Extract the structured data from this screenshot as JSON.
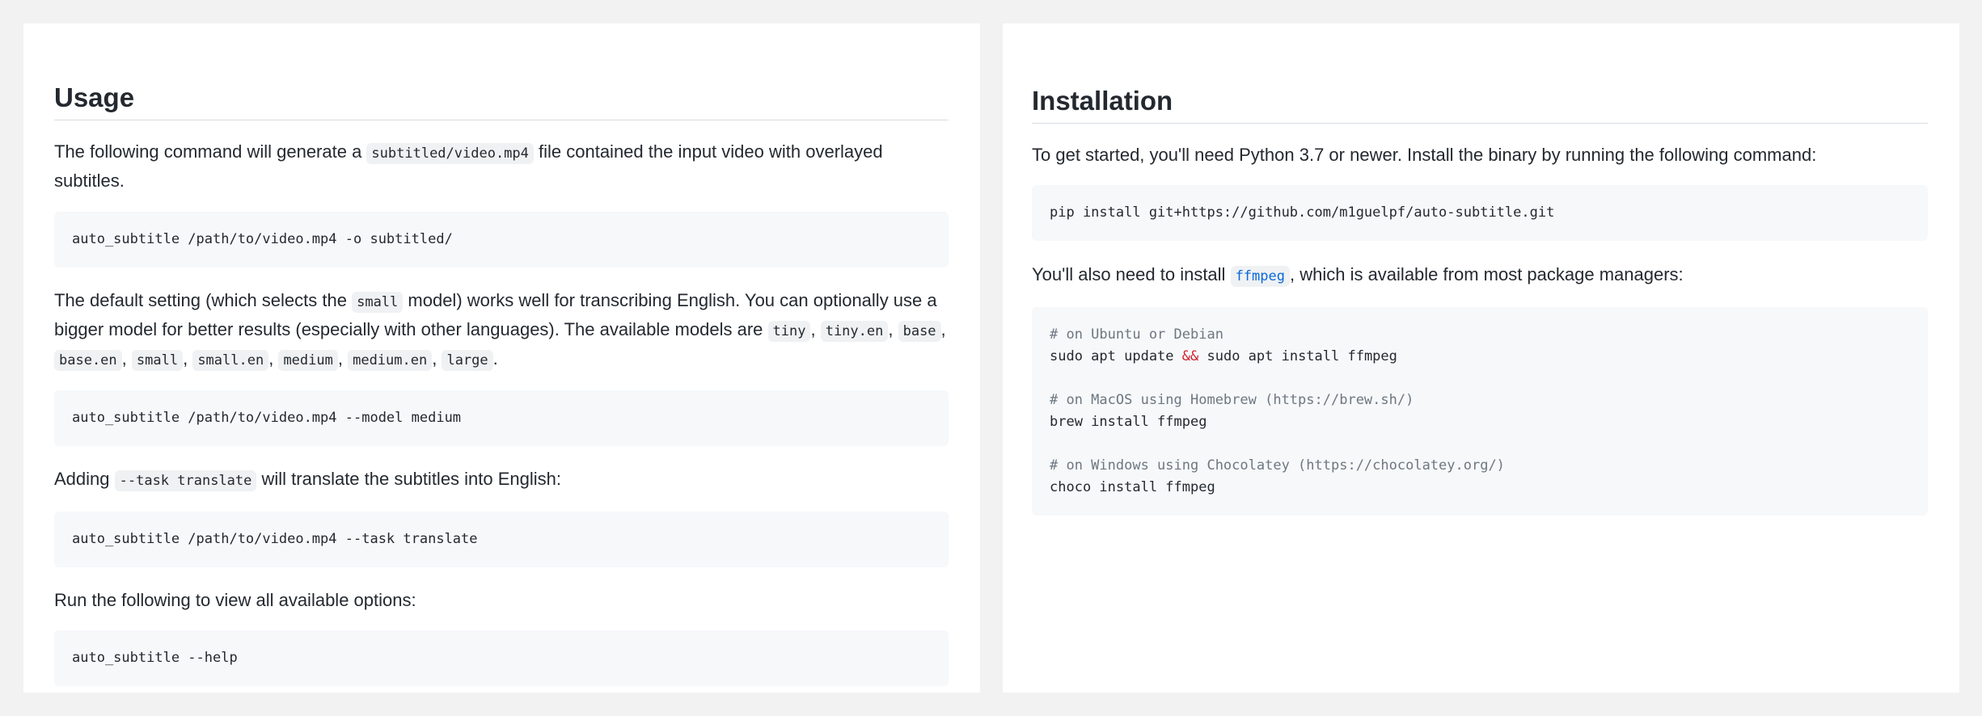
{
  "usage": {
    "title": "Usage",
    "p1_before": "The following command will generate a ",
    "p1_code": "subtitled/video.mp4",
    "p1_after": " file contained the input video with overlayed subtitles.",
    "cmd1": "auto_subtitle /path/to/video.mp4 -o subtitled/",
    "p2_before": "The default setting (which selects the ",
    "p2_code": "small",
    "p2_after": " model) works well for transcribing English. You can optionally use a bigger model for better results (especially with other languages). The available models are ",
    "models": [
      "tiny",
      "tiny.en",
      "base",
      "base.en",
      "small",
      "small.en",
      "medium",
      "medium.en",
      "large"
    ],
    "sep": ", ",
    "period": ".",
    "cmd2": "auto_subtitle /path/to/video.mp4 --model medium",
    "p3_before": "Adding ",
    "p3_code": "--task translate",
    "p3_after": " will translate the subtitles into English:",
    "cmd3": "auto_subtitle /path/to/video.mp4 --task translate",
    "p4": "Run the following to view all available options:",
    "cmd4": "auto_subtitle --help"
  },
  "installation": {
    "title": "Installation",
    "p1": "To get started, you'll need Python 3.7 or newer. Install the binary by running the following command:",
    "cmd1": "pip install git+https://github.com/m1guelpf/auto-subtitle.git",
    "p2_before": "You'll also need to install ",
    "p2_code": "ffmpeg",
    "p2_after": ", which is available from most package managers:",
    "comment_ubuntu": "# on Ubuntu or Debian",
    "ubuntu_part1": "sudo apt update ",
    "ubuntu_op": "&&",
    "ubuntu_part2": " sudo apt install ffmpeg",
    "comment_macos": "# on MacOS using Homebrew (https://brew.sh/)",
    "macos_cmd": "brew install ffmpeg",
    "comment_windows": "# on Windows using Chocolatey (https://chocolatey.org/)",
    "windows_cmd": "choco install ffmpeg"
  }
}
